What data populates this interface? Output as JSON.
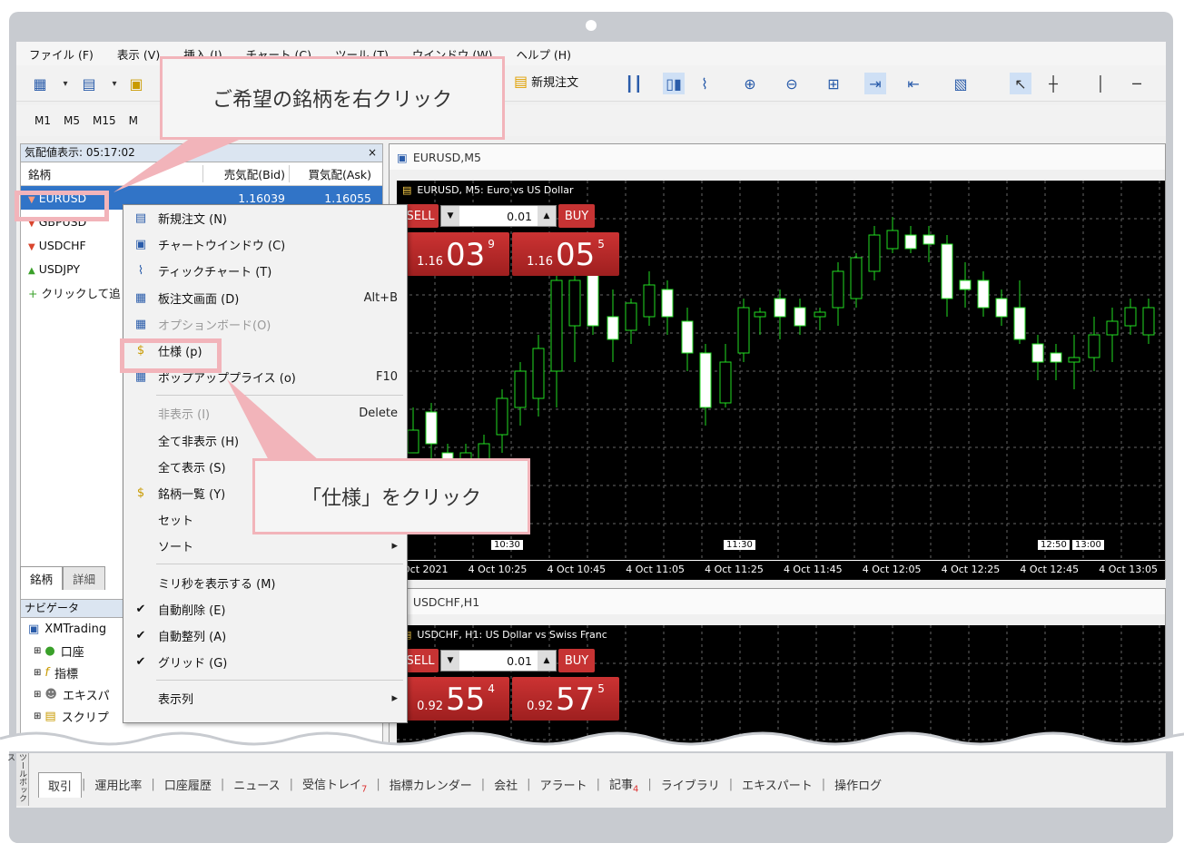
{
  "menu": [
    "ファイル (F)",
    "表示 (V)",
    "挿入 (I)",
    "チャート (C)",
    "ツール (T)",
    "ウインドウ (W)",
    "ヘルプ (H)"
  ],
  "toolbar": {
    "new_order": "新規注文"
  },
  "timeframes": [
    "M1",
    "M5",
    "M15",
    "M"
  ],
  "market_watch": {
    "title": "気配値表示: 05:17:02",
    "close": "×",
    "headers": {
      "symbol": "銘柄",
      "bid": "売気配(Bid)",
      "ask": "買気配(Ask)"
    },
    "rows": [
      {
        "symbol": "EURUSD",
        "bid": "1.16039",
        "ask": "1.16055",
        "dir": "down"
      },
      {
        "symbol": "GBPUSD",
        "dir": "down"
      },
      {
        "symbol": "USDCHF",
        "dir": "down"
      },
      {
        "symbol": "USDJPY",
        "dir": "up"
      }
    ],
    "add_row": "クリックして追",
    "tabs": [
      "銘柄",
      "詳細"
    ]
  },
  "navigator": {
    "title": "ナビゲータ",
    "items": [
      "XMTrading",
      "口座",
      "指標",
      "エキスパ",
      "スクリプ"
    ]
  },
  "context_menu": {
    "items": [
      {
        "icon": "new-order",
        "label": "新規注文 (N)",
        "shortcut": ""
      },
      {
        "icon": "chart-window",
        "label": "チャートウインドウ (C)",
        "shortcut": ""
      },
      {
        "icon": "tick-chart",
        "label": "ティックチャート (T)",
        "shortcut": ""
      },
      {
        "icon": "depth",
        "label": "板注文画面 (D)",
        "shortcut": "Alt+B"
      },
      {
        "icon": "option-board",
        "label": "オプションボード(O)",
        "shortcut": ""
      },
      {
        "icon": "spec",
        "label": "仕様 (p)",
        "shortcut": ""
      },
      {
        "icon": "popup",
        "label": "ポップアッププライス (o)",
        "shortcut": "F10"
      },
      {
        "sep": true
      },
      {
        "label": "非表示 (I)",
        "shortcut": "Delete"
      },
      {
        "label": "全て非表示 (H)",
        "shortcut": ""
      },
      {
        "label": "全て表示 (S)",
        "shortcut": ""
      },
      {
        "icon": "symbols",
        "label": "銘柄一覧 (Y)",
        "shortcut": ""
      },
      {
        "label": "セット",
        "shortcut": ""
      },
      {
        "label": "ソート",
        "shortcut": "▸"
      },
      {
        "sep": true
      },
      {
        "label": "ミリ秒を表示する (M)",
        "shortcut": ""
      },
      {
        "check": "✔",
        "label": "自動削除 (E)",
        "shortcut": ""
      },
      {
        "check": "✔",
        "label": "自動整列 (A)",
        "shortcut": ""
      },
      {
        "check": "✔",
        "label": "グリッド (G)",
        "shortcut": ""
      },
      {
        "sep": true
      },
      {
        "label": "表示列",
        "shortcut": "▸"
      }
    ]
  },
  "chart1": {
    "window_title": "EURUSD,M5",
    "inner_title": "EURUSD, M5:  Euro vs US Dollar",
    "sell": "SELL",
    "buy": "BUY",
    "lot": "0.01",
    "sell_price": {
      "prefix": "1.16",
      "big": "03",
      "sup": "9"
    },
    "buy_price": {
      "prefix": "1.16",
      "big": "05",
      "sup": "5"
    },
    "x_labels": [
      "Oct 2021",
      "4 Oct 10:25",
      "4 Oct 10:45",
      "4 Oct 11:05",
      "4 Oct 11:25",
      "4 Oct 11:45",
      "4 Oct 12:05",
      "4 Oct 12:25",
      "4 Oct 12:45",
      "4 Oct 13:05"
    ],
    "markers": [
      "10:30",
      "11:30",
      "12:50",
      "13:00"
    ]
  },
  "chart2": {
    "window_title": "USDCHF,H1",
    "inner_title": "USDCHF, H1:  US Dollar vs Swiss Franc",
    "sell": "SELL",
    "buy": "BUY",
    "lot": "0.01",
    "sell_price": {
      "prefix": "0.92",
      "big": "55",
      "sup": "4"
    },
    "buy_price": {
      "prefix": "0.92",
      "big": "57",
      "sup": "5"
    }
  },
  "callouts": {
    "right_click": "ご希望の銘柄を右クリック",
    "spec_click": "「仕様」をクリック"
  },
  "bottom_tabs": {
    "side": "ツールボックス",
    "tabs": [
      "取引",
      "運用比率",
      "口座履歴",
      "ニュース",
      "受信トレイ",
      "指標カレンダー",
      "会社",
      "アラート",
      "記事",
      "ライブラリ",
      "エキスパート",
      "操作ログ"
    ],
    "inbox_badge": "7",
    "articles_badge": "4"
  },
  "colors": {
    "accent_pink": "#f2b4ba",
    "sell_red": "#c63333",
    "bull_green": "#22dd22",
    "selected_blue": "#3174c7"
  }
}
